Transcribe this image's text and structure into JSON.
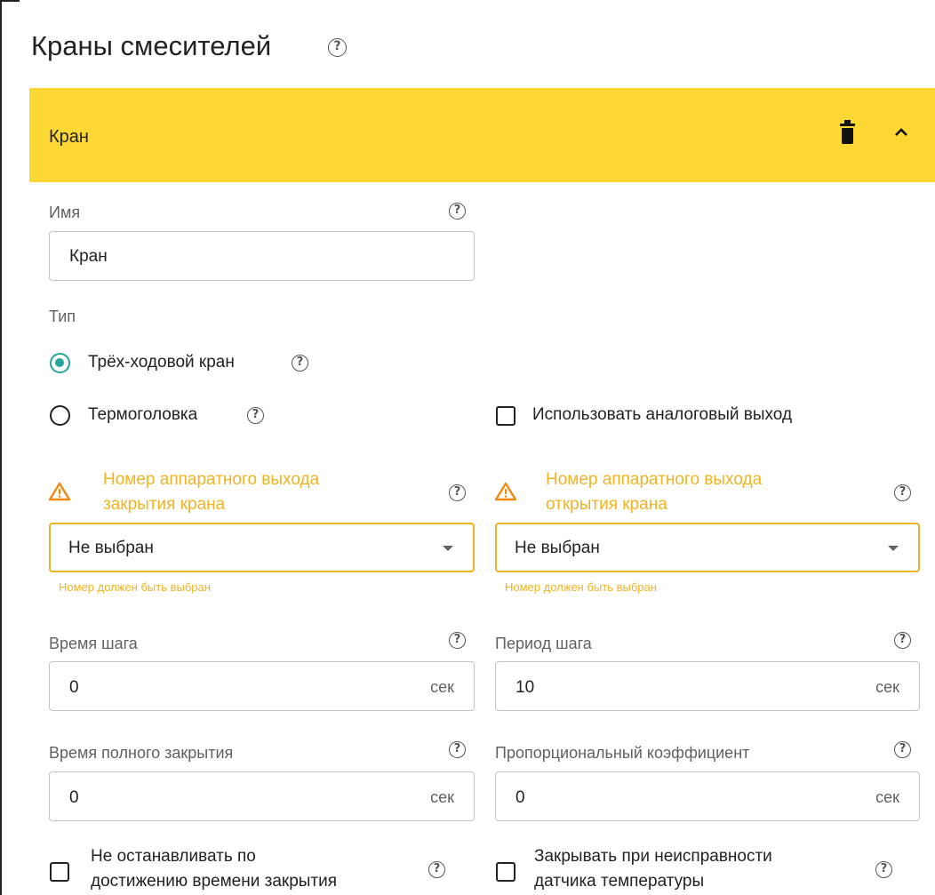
{
  "page": {
    "title": "Краны смесителей"
  },
  "panel": {
    "title": "Кран"
  },
  "name_field": {
    "label": "Имя",
    "value": "Кран"
  },
  "type": {
    "label": "Тип",
    "options": [
      {
        "label": "Трёх-ходовой кран",
        "selected": true
      },
      {
        "label": "Термоголовка",
        "selected": false
      }
    ]
  },
  "analog_output": {
    "label": "Использовать аналоговый выход",
    "checked": false
  },
  "close_output": {
    "label_line1": "Номер аппаратного выхода",
    "label_line2": "закрытия крана",
    "value": "Не выбран",
    "error": "Номер должен быть выбран"
  },
  "open_output": {
    "label_line1": "Номер аппаратного выхода",
    "label_line2": "открытия крана",
    "value": "Не выбран",
    "error": "Номер должен быть выбран"
  },
  "step_time": {
    "label": "Время шага",
    "value": "0",
    "unit": "сек"
  },
  "step_period": {
    "label": "Период шага",
    "value": "10",
    "unit": "сек"
  },
  "full_close_time": {
    "label": "Время полного закрытия",
    "value": "0",
    "unit": "сек"
  },
  "proportional_coef": {
    "label": "Пропорциональный коэффициент",
    "value": "0",
    "unit": "сек"
  },
  "no_stop": {
    "label_line1": "Не останавливать по",
    "label_line2": "достижению времени закрытия",
    "checked": false
  },
  "close_on_fault": {
    "label_line1": "Закрывать при неисправности",
    "label_line2": "датчика температуры",
    "checked": false
  },
  "colors": {
    "header": "#fdd835",
    "accent": "#26a69a",
    "warning": "#f0b323"
  }
}
